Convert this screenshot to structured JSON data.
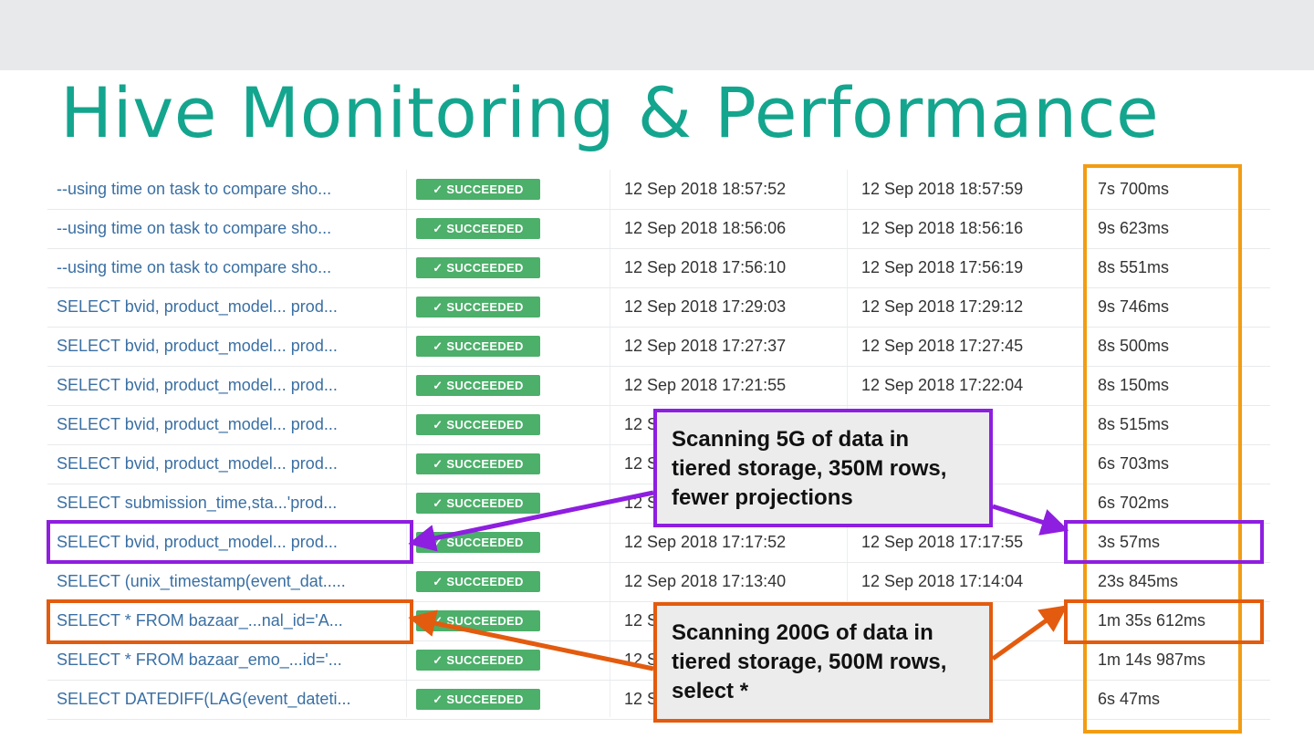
{
  "title": "Hive Monitoring & Performance",
  "rows": [
    {
      "query": "--using time on task to compare sho...",
      "status": "✓ SUCCEEDED",
      "start": "12 Sep 2018 18:57:52",
      "end": "12 Sep 2018 18:57:59",
      "duration": "7s 700ms"
    },
    {
      "query": "--using time on task to compare sho...",
      "status": "✓ SUCCEEDED",
      "start": "12 Sep 2018 18:56:06",
      "end": "12 Sep 2018 18:56:16",
      "duration": "9s 623ms"
    },
    {
      "query": "--using time on task to compare sho...",
      "status": "✓ SUCCEEDED",
      "start": "12 Sep 2018 17:56:10",
      "end": "12 Sep 2018 17:56:19",
      "duration": "8s 551ms"
    },
    {
      "query": "SELECT bvid, product_model... prod...",
      "status": "✓ SUCCEEDED",
      "start": "12 Sep 2018 17:29:03",
      "end": "12 Sep 2018 17:29:12",
      "duration": "9s 746ms"
    },
    {
      "query": "SELECT bvid, product_model... prod...",
      "status": "✓ SUCCEEDED",
      "start": "12 Sep 2018 17:27:37",
      "end": "12 Sep 2018 17:27:45",
      "duration": "8s 500ms"
    },
    {
      "query": "SELECT bvid, product_model... prod...",
      "status": "✓ SUCCEEDED",
      "start": "12 Sep 2018 17:21:55",
      "end": "12 Sep 2018 17:22:04",
      "duration": "8s 150ms"
    },
    {
      "query": "SELECT bvid, product_model... prod...",
      "status": "✓ SUCCEEDED",
      "start": "12 S",
      "end": ":20:43",
      "duration": "8s 515ms"
    },
    {
      "query": "SELECT bvid, product_model... prod...",
      "status": "✓ SUCCEEDED",
      "start": "12 S",
      "end": "7:19:51",
      "duration": "6s 703ms"
    },
    {
      "query": "SELECT submission_time,sta...'prod...",
      "status": "✓ SUCCEEDED",
      "start": "12 S",
      "end": ":18:47",
      "duration": "6s 702ms"
    },
    {
      "query": "SELECT bvid, product_model... prod...",
      "status": "✓ SUCCEEDED",
      "start": "12 Sep 2018 17:17:52",
      "end": "12 Sep 2018 17:17:55",
      "duration": "3s 57ms"
    },
    {
      "query": "SELECT (unix_timestamp(event_dat.....",
      "status": "✓ SUCCEEDED",
      "start": "12 Sep 2018 17:13:40",
      "end": "12 Sep 2018 17:14:04",
      "duration": "23s 845ms"
    },
    {
      "query": "SELECT * FROM bazaar_...nal_id='A...",
      "status": "✓ SUCCEEDED",
      "start": "12 S",
      "end": "7:14:42",
      "duration": "1m 35s 612ms"
    },
    {
      "query": "SELECT * FROM bazaar_emo_...id='...",
      "status": "✓ SUCCEEDED",
      "start": "12 S",
      "end": ":12:43",
      "duration": "1m 14s 987ms"
    },
    {
      "query": "SELECT DATEDIFF(LAG(event_dateti...",
      "status": "✓ SUCCEEDED",
      "start": "12 S",
      "end": "7:09:01",
      "duration": "6s 47ms"
    }
  ],
  "callouts": {
    "fast": "Scanning 5G of data in tiered storage, 350M rows, fewer projections",
    "slow": "Scanning 200G of data in tiered storage, 500M rows, select *"
  },
  "colors": {
    "title": "#14a58e",
    "status_badge": "#4caf6a",
    "duration_box": "#f39c12",
    "fast_highlight": "#8e1ee0",
    "slow_highlight": "#e35b0e"
  }
}
